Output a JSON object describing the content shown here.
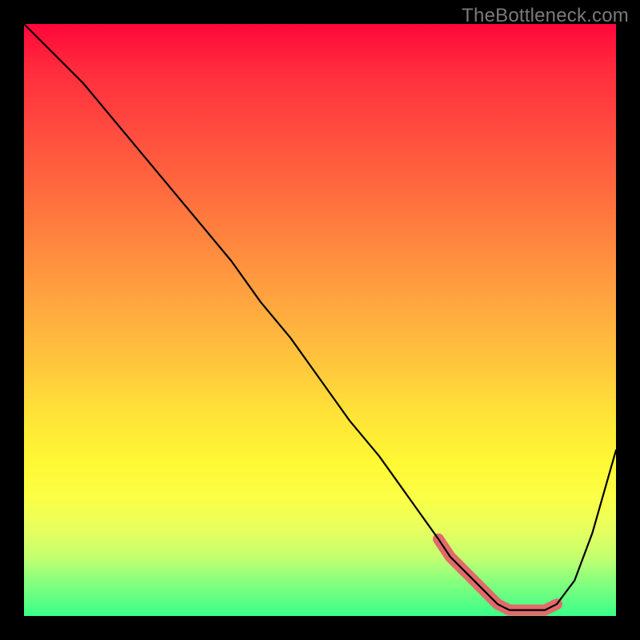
{
  "watermark": {
    "text": "TheBottleneck.com"
  },
  "chart_data": {
    "type": "line",
    "title": "",
    "xlabel": "",
    "ylabel": "",
    "xlim": [
      0,
      100
    ],
    "ylim": [
      0,
      100
    ],
    "grid": false,
    "legend": false,
    "series": [
      {
        "name": "curve",
        "color": "#000000",
        "x": [
          0,
          5,
          10,
          15,
          20,
          25,
          30,
          35,
          40,
          45,
          50,
          55,
          60,
          65,
          70,
          72,
          75,
          78,
          80,
          82,
          85,
          88,
          90,
          93,
          96,
          100
        ],
        "values": [
          100,
          95,
          90,
          84,
          78,
          72,
          66,
          60,
          53,
          47,
          40,
          33,
          27,
          20,
          13,
          10,
          7,
          4,
          2,
          1,
          1,
          1,
          2,
          6,
          14,
          28
        ]
      }
    ],
    "highlight": {
      "name": "flat-region",
      "color": "#e16a6a",
      "x": [
        70,
        72,
        75,
        78,
        80,
        82,
        85,
        88,
        90
      ],
      "values": [
        13,
        10,
        7,
        4,
        2,
        1,
        1,
        1,
        2
      ]
    }
  }
}
